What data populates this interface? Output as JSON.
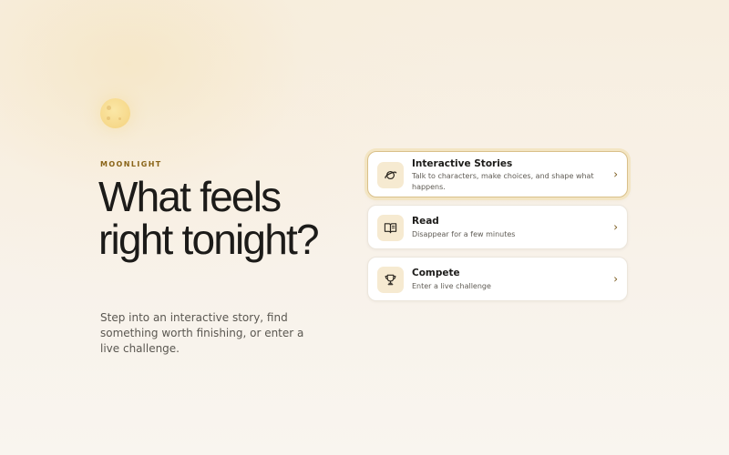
{
  "brand": {
    "eyebrow": "MOONLIGHT",
    "logo_icon": "moon-icon"
  },
  "hero": {
    "title": "What feels right tonight?",
    "subtitle": "Step into an interactive story, find something worth finishing, or enter a live challenge."
  },
  "options": [
    {
      "icon": "planet-icon",
      "title": "Interactive Stories",
      "description": "Talk to characters, make choices, and shape what happens.",
      "chevron": "›",
      "selected": true
    },
    {
      "icon": "book-icon",
      "title": "Read",
      "description": "Disappear for a few minutes",
      "chevron": "›",
      "selected": false
    },
    {
      "icon": "trophy-icon",
      "title": "Compete",
      "description": "Enter a live challenge",
      "chevron": "›",
      "selected": false
    }
  ],
  "colors": {
    "background": "#f8f2e8",
    "accent": "#8a6418",
    "moon": "#f6d88a",
    "icon_tile": "#f6ead1",
    "selected_ring": "#f3e5c3"
  }
}
